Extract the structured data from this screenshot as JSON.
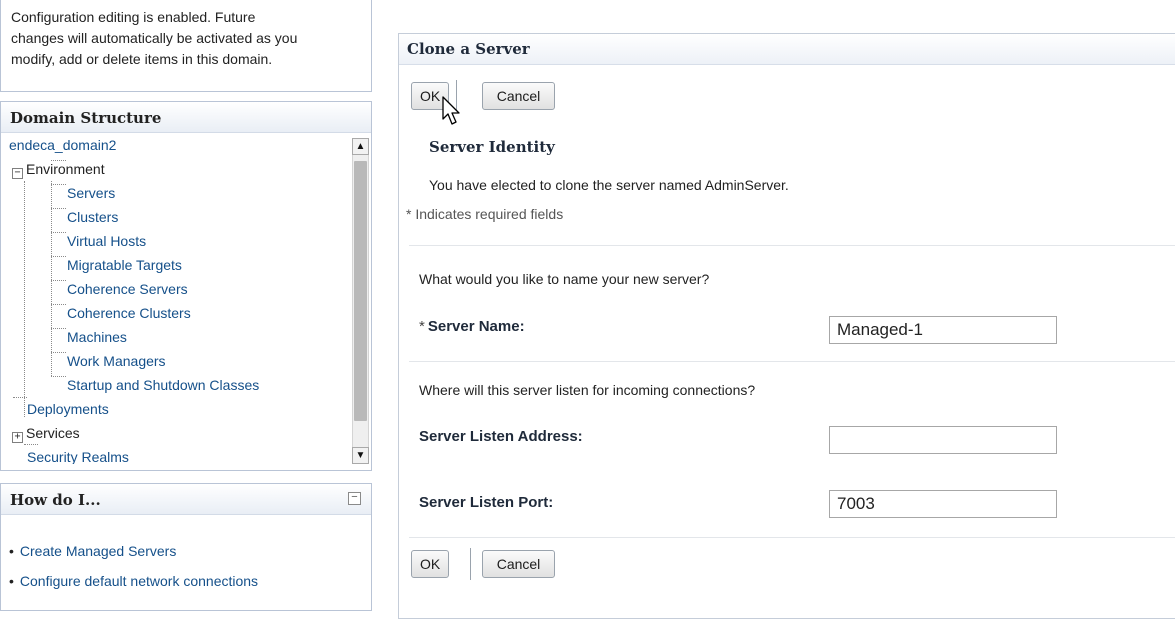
{
  "notice": {
    "lines": [
      "Configuration editing is enabled. Future",
      "changes will automatically be activated as you",
      "modify, add or delete items in this domain."
    ]
  },
  "domain_structure": {
    "title": "Domain Structure",
    "root": "endeca_domain2",
    "environment": "Environment",
    "environment_children": [
      "Servers",
      "Clusters",
      "Virtual Hosts",
      "Migratable Targets",
      "Coherence Servers",
      "Coherence Clusters",
      "Machines",
      "Work Managers",
      "Startup and Shutdown Classes"
    ],
    "deployments": "Deployments",
    "services": "Services",
    "security_realms": "Security Realms"
  },
  "how_do_i": {
    "title": "How do I...",
    "items": [
      "Create Managed Servers",
      "Configure default network connections"
    ]
  },
  "clone": {
    "title": "Clone a Server",
    "ok_label": "OK",
    "cancel_label": "Cancel",
    "section_title": "Server Identity",
    "elected_text": "You have elected to clone the server named AdminServer.",
    "required_note": "* Indicates required fields",
    "name_question": "What would you like to name your new server?",
    "server_name_label": "Server Name:",
    "server_name_value": "Managed-1",
    "listen_question": "Where will this server listen for incoming connections?",
    "listen_address_label": "Server Listen Address:",
    "listen_address_value": "",
    "listen_port_label": "Server Listen Port:",
    "listen_port_value": "7003"
  }
}
